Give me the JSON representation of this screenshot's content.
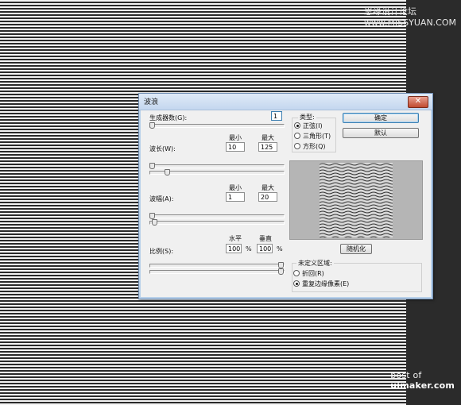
{
  "watermark_top": "思缘设计论坛 www.MISSYUAN.COM",
  "watermark_bottom": {
    "prefix": "post of ",
    "brand": "uimaker.com"
  },
  "dialog": {
    "title": "波浪",
    "close_glyph": "✕",
    "generators": {
      "label": "生成器数(G):",
      "value": "1",
      "level": 0.0
    },
    "wavelength": {
      "label": "波长(W):",
      "min_header": "最小",
      "max_header": "最大",
      "min_value": "10",
      "max_value": "125",
      "min_level": 0.0,
      "max_level": 0.12
    },
    "amplitude": {
      "label": "波幅(A):",
      "min_header": "最小",
      "max_header": "最大",
      "min_value": "1",
      "max_value": "20",
      "min_level": 0.0,
      "max_level": 0.02
    },
    "scale": {
      "label": "比例(S):",
      "h_header": "水平",
      "v_header": "垂直",
      "h_value": "100",
      "v_value": "100",
      "unit": "%",
      "h_level": 1.0,
      "v_level": 1.0
    },
    "type": {
      "title": "类型:",
      "options": [
        "正弦(I)",
        "三角形(T)",
        "方形(Q)"
      ],
      "selected_index": 0
    },
    "ok_label": "确定",
    "default_label": "默认",
    "randomize_label": "随机化",
    "undefined_area": {
      "title": "未定义区域:",
      "options": [
        "折回(R)",
        "重复边缘像素(E)"
      ],
      "selected_index": 1
    }
  }
}
